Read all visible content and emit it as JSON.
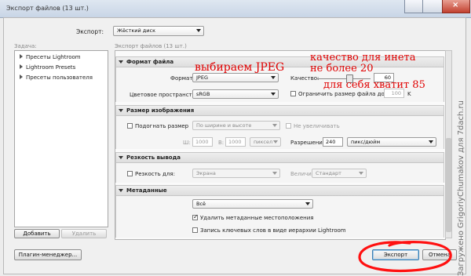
{
  "window": {
    "title": "Экспорт файлов (13 шт.)"
  },
  "export_to": {
    "label": "Экспорт:",
    "value": "Жёсткий диск"
  },
  "presets": {
    "label": "Задача:",
    "items": [
      "Пресеты Lightroom",
      "Lightroom Presets",
      "Пресеты пользователя"
    ],
    "add_label": "Добавить",
    "remove_label": "Удалить"
  },
  "settings": {
    "header": "Экспорт файлов (13 шт.)",
    "file_format": {
      "title": "Формат файла",
      "format_label": "Формат:",
      "format_value": "JPEG",
      "quality_label": "Качество:",
      "quality_value": "60",
      "quality_fraction": 0.6,
      "colorspace_label": "Цветовое пространство:",
      "colorspace_value": "sRGB",
      "limit_label": "Ограничить размер файла до:",
      "limit_value": "100",
      "limit_unit": "K"
    },
    "image_size": {
      "title": "Размер изображения",
      "fit_label": "Подогнать размер",
      "fit_value": "По ширине и высоте",
      "no_enlarge_label": "Не увеличивать",
      "w_label": "Ш:",
      "w_value": "1000",
      "h_label": "В:",
      "h_value": "1000",
      "unit_value": "пиксел",
      "resolution_label": "Разрешение:",
      "resolution_value": "240",
      "resolution_unit": "пикс/дюйм"
    },
    "sharpening": {
      "title": "Резкость вывода",
      "sharpen_label": "Резкость для:",
      "sharpen_value": "Экрана",
      "amount_label": "Величина:",
      "amount_value": "Стандарт"
    },
    "metadata": {
      "title": "Метаданные",
      "include_value": "Всё",
      "remove_location_label": "Удалить метаданные местоположения",
      "hierarchy_label": "Запись ключевых слов в виде иерархии Lightroom"
    }
  },
  "buttons": {
    "plugin_manager": "Плагин-менеджер...",
    "export": "Экспорт",
    "cancel": "Отмена"
  },
  "annotations": {
    "choose_jpeg": "выбираем JPEG",
    "quality_web_1": "качество для инета",
    "quality_web_2": "не более 20",
    "quality_self": "для себя хватит  85"
  },
  "watermark": "Загружено GrigoriyChumakov для 7dach.ru",
  "colors": {
    "annotation": "#e00000",
    "titlebar_close": "#c2402f"
  }
}
